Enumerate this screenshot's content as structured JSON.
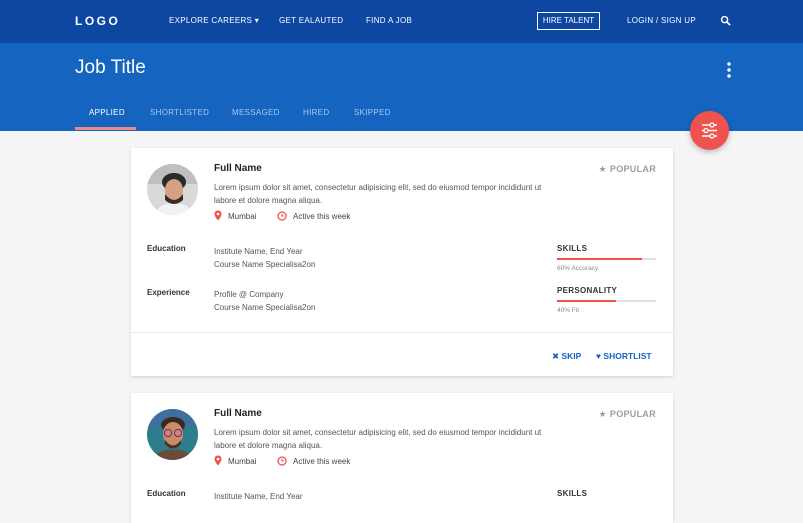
{
  "nav": {
    "logo": "LOGO",
    "links": [
      "EXPLORE CAREERS",
      "GET EALAUTED",
      "FIND A JOB"
    ],
    "explore_caret": "▾",
    "hire": "HIRE TALENT",
    "login": "LOGIN / SIGN UP"
  },
  "header": {
    "title": "Job Title",
    "tabs": [
      "APPLIED",
      "SHORTLISTED",
      "MESSAGED",
      "HIRED",
      "SKIPPED"
    ],
    "active_tab": "APPLIED"
  },
  "colors": {
    "nav_bg": "#0d47a1",
    "header_bg": "#1565c0",
    "accent": "#ef5350",
    "action_blue": "#1565c0"
  },
  "candidates": [
    {
      "name": "Full Name",
      "badge": "POPULAR",
      "description": "Lorem ipsum dolor sit amet, consectetur adipisicing elit, sed do eiusmod tempor incididunt ut labore et dolore magna aliqua.",
      "location": "Mumbai",
      "activity": "Active this week",
      "education_label": "Education",
      "education": [
        "Institute Name, End Year",
        "Course Name Specialisa2on"
      ],
      "experience_label": "Experience",
      "experience": [
        "Profile @ Company",
        "Course Name Specialisa2on"
      ],
      "skills": {
        "label": "SKILLS",
        "value": 0.86,
        "caption": "60% Accuracy"
      },
      "personality": {
        "label": "PERSONALITY",
        "value": 0.6,
        "caption": "40% Fit"
      },
      "actions": {
        "skip": "SKIP",
        "shortlist": "SHORTLIST"
      }
    },
    {
      "name": "Full Name",
      "badge": "POPULAR",
      "description": "Lorem ipsum dolor sit amet, consectetur adipisicing elit, sed do eiusmod tempor incididunt ut labore et dolore magna aliqua.",
      "location": "Mumbai",
      "activity": "Active this week",
      "education_label": "Education",
      "education": [
        "Institute Name, End Year"
      ],
      "skills": {
        "label": "SKILLS"
      }
    }
  ]
}
